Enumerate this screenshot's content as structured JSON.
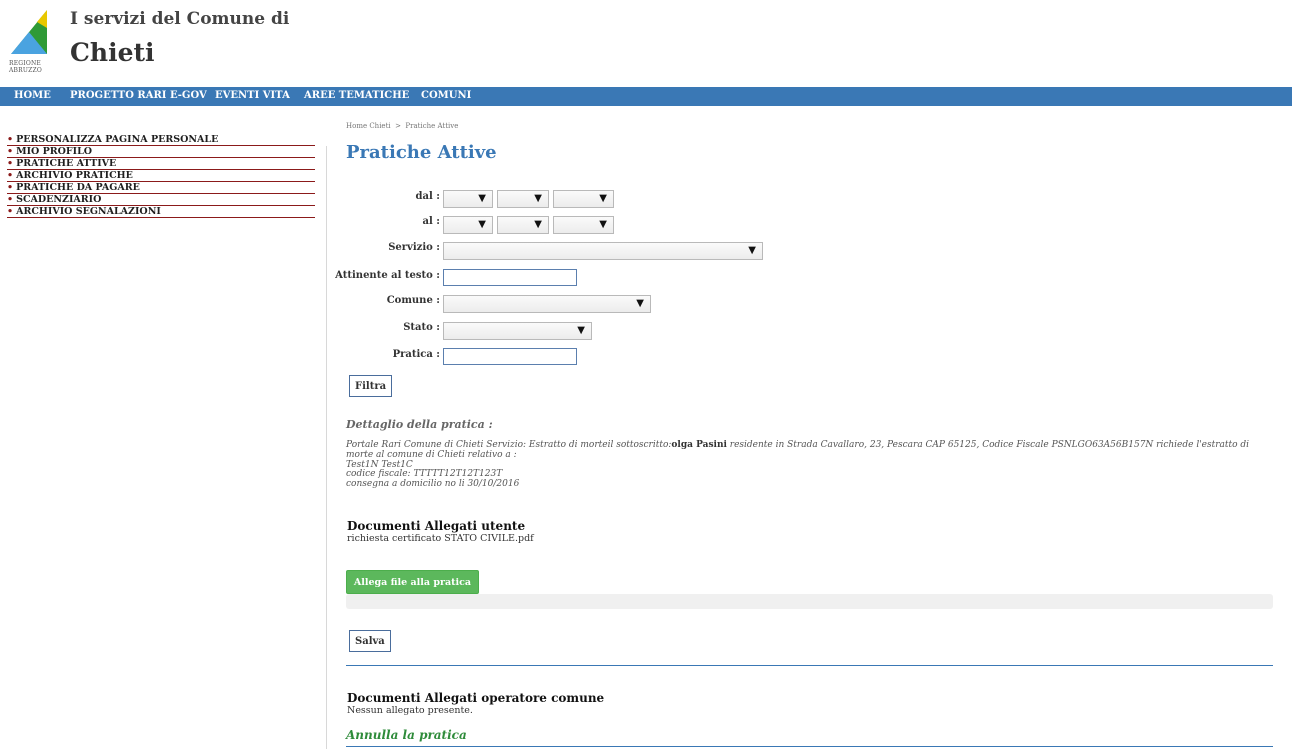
{
  "header": {
    "logo_caption_line1": "REGIONE",
    "logo_caption_line2": "ABRUZZO",
    "subtitle": "I servizi del Comune di",
    "city": "Chieti"
  },
  "topnav": [
    "HOME",
    "PROGETTO RARI E-GOV",
    "EVENTI VITA",
    "AREE TEMATICHE",
    "COMUNI"
  ],
  "sidebar": [
    "PERSONALIZZA PAGINA PERSONALE",
    "MIO PROFILO",
    "PRATICHE ATTIVE",
    "ARCHIVIO PRATICHE",
    "PRATICHE DA PAGARE",
    "SCADENZIARIO",
    "ARCHIVIO SEGNALAZIONI"
  ],
  "breadcrumb": {
    "home": "Home Chieti",
    "sep": ">",
    "current": "Pratiche Attive"
  },
  "page_title": "Pratiche Attive",
  "form": {
    "dal_label": "dal :",
    "al_label": "al :",
    "servizio_label": "Servizio :",
    "attinente_label": "Attinente al testo :",
    "comune_label": "Comune :",
    "stato_label": "Stato :",
    "pratica_label": "Pratica :",
    "filtra": "Filtra"
  },
  "dettaglio": {
    "title": "Dettaglio della pratica :",
    "text_pre": "Portale Rari Comune di Chieti Servizio: Estratto di morteil sottoscritto:",
    "name": "olga Pasini",
    "text_post": " residente in Strada Cavallaro, 23, Pescara CAP 65125, Codice Fiscale PSNLGO63A56B157N richiede l'estratto di morte al comune di Chieti relativo a :",
    "line2": "Test1N Test1C",
    "line3": "codice fiscale: TTTTT12T12T123T",
    "line4": "consegna a domicilio no li 30/10/2016"
  },
  "docs_user": {
    "title": "Documenti Allegati utente",
    "file": "richiesta certificato STATO CIVILE.pdf"
  },
  "allega_label": "Allega file alla pratica",
  "upload_progress": 0,
  "salva": "Salva",
  "docs_operator": {
    "title": "Documenti Allegati operatore comune",
    "text": "Nessun allegato presente."
  },
  "annulla": "Annulla la pratica",
  "colors": {
    "accent": "#3a78b5",
    "sidebar_rule": "#8b1a1a",
    "green": "#5cb85c"
  }
}
